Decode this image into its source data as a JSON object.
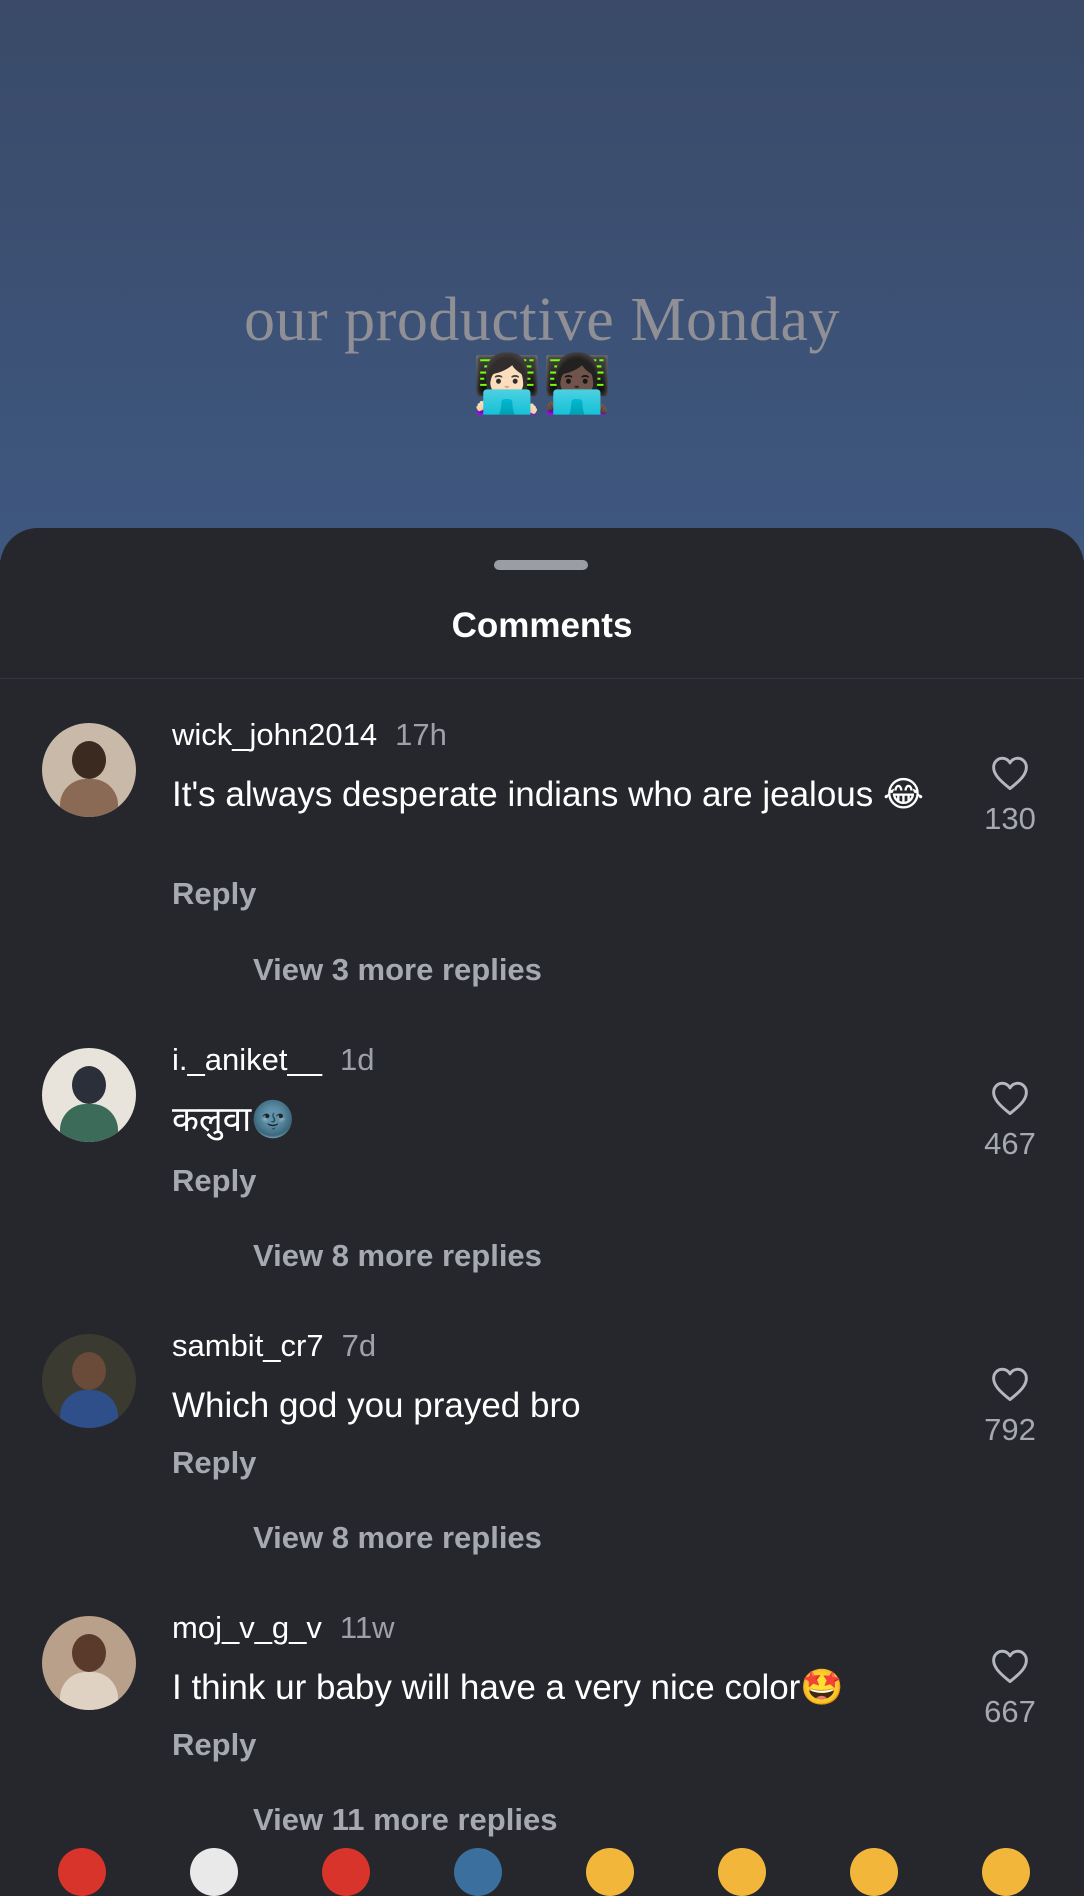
{
  "video": {
    "caption": "our productive Monday",
    "caption_emoji": "👩🏻‍💻👩🏿‍💻"
  },
  "sheet": {
    "title": "Comments"
  },
  "comments": [
    {
      "username": "wick_john2014",
      "time": "17h",
      "text": "It's always desperate indians who are jealous 😂",
      "reply_label": "Reply",
      "view_replies": "View 3 more replies",
      "likes": "130"
    },
    {
      "username": "i._aniket__",
      "time": "1d",
      "text": "कलुवा🌚",
      "reply_label": "Reply",
      "view_replies": "View 8 more replies",
      "likes": "467"
    },
    {
      "username": "sambit_cr7",
      "time": "7d",
      "text": "Which god you prayed bro",
      "reply_label": "Reply",
      "view_replies": "View 8 more replies",
      "likes": "792"
    },
    {
      "username": "moj_v_g_v",
      "time": "11w",
      "text": "I think ur baby will have a very nice color🤩",
      "reply_label": "Reply",
      "view_replies": "View 11 more replies",
      "likes": "667"
    }
  ],
  "colors": {
    "sheet_bg": "#25272d",
    "text_primary": "#ffffff",
    "text_secondary": "#a6a9b0"
  },
  "icons": {
    "like": "heart-outline-icon"
  }
}
